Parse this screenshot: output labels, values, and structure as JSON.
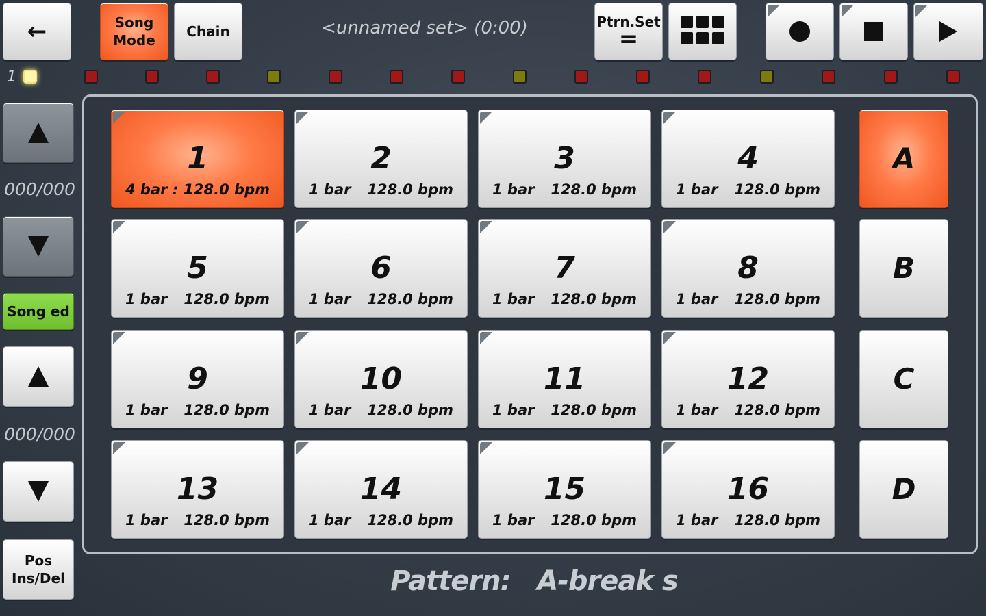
{
  "header": {
    "back_label": "←",
    "song_mode_line1": "Song",
    "song_mode_line2": "Mode",
    "chain_label": "Chain",
    "set_title": "<unnamed set> (0:00)",
    "ptrn_set_label": "Ptrn.Set",
    "ptrn_set_symbol": "="
  },
  "transport": {
    "record_icon": "record-icon",
    "stop_icon": "stop-icon",
    "play_icon": "play-icon"
  },
  "leds": {
    "bar_number": "1",
    "states": [
      "lit",
      "red",
      "red",
      "red",
      "olive",
      "red",
      "red",
      "red",
      "olive",
      "red",
      "red",
      "red",
      "olive",
      "red",
      "red",
      "red"
    ],
    "colors": {
      "red": "#a01818",
      "olive": "#7d7a10",
      "lit": "#fff6b0"
    }
  },
  "sidebar": {
    "counter_top": "000/000",
    "song_ed_label": "Song ed",
    "counter_bottom": "000/000",
    "pos_line1": "Pos",
    "pos_line2": "Ins/Del"
  },
  "pads": [
    {
      "num": "1",
      "bars": "4 bar : 1",
      "bpm": "128.0 bpm",
      "active": true
    },
    {
      "num": "2",
      "bars": "1 bar",
      "bpm": "128.0 bpm"
    },
    {
      "num": "3",
      "bars": "1 bar",
      "bpm": "128.0 bpm"
    },
    {
      "num": "4",
      "bars": "1 bar",
      "bpm": "128.0 bpm"
    },
    {
      "num": "5",
      "bars": "1 bar",
      "bpm": "128.0 bpm"
    },
    {
      "num": "6",
      "bars": "1 bar",
      "bpm": "128.0 bpm"
    },
    {
      "num": "7",
      "bars": "1 bar",
      "bpm": "128.0 bpm"
    },
    {
      "num": "8",
      "bars": "1 bar",
      "bpm": "128.0 bpm"
    },
    {
      "num": "9",
      "bars": "1 bar",
      "bpm": "128.0 bpm"
    },
    {
      "num": "10",
      "bars": "1 bar",
      "bpm": "128.0 bpm"
    },
    {
      "num": "11",
      "bars": "1 bar",
      "bpm": "128.0 bpm"
    },
    {
      "num": "12",
      "bars": "1 bar",
      "bpm": "128.0 bpm"
    },
    {
      "num": "13",
      "bars": "1 bar",
      "bpm": "128.0 bpm"
    },
    {
      "num": "14",
      "bars": "1 bar",
      "bpm": "128.0 bpm"
    },
    {
      "num": "15",
      "bars": "1 bar",
      "bpm": "128.0 bpm"
    },
    {
      "num": "16",
      "bars": "1 bar",
      "bpm": "128.0 bpm"
    }
  ],
  "banks": [
    {
      "label": "A",
      "active": true
    },
    {
      "label": "B"
    },
    {
      "label": "C"
    },
    {
      "label": "D"
    }
  ],
  "footer": {
    "pattern_label": "Pattern:",
    "pattern_name": "A-break s"
  },
  "colors": {
    "accent": "#ff7a47",
    "song_ed_green": "#6fbf2f"
  }
}
